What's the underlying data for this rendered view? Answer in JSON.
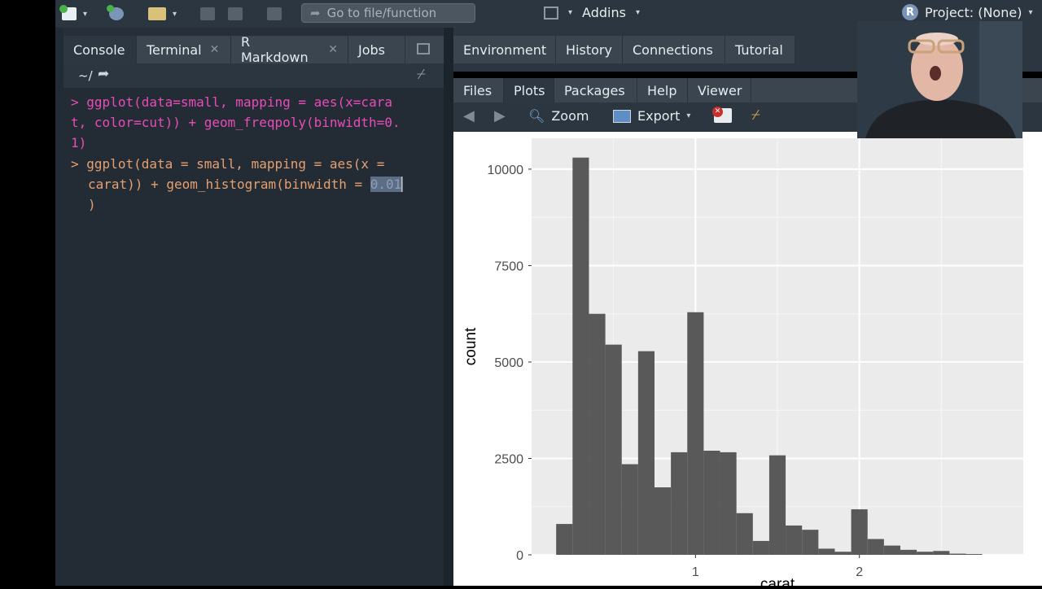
{
  "toolbar": {
    "goto_placeholder": "Go to file/function",
    "addins_label": "Addins",
    "project_label": "Project: (None)",
    "project_logo": "R"
  },
  "console_pane": {
    "tabs": [
      {
        "label": "Console",
        "closable": false
      },
      {
        "label": "Terminal",
        "closable": true
      },
      {
        "label": "R Markdown",
        "closable": true
      },
      {
        "label": "Jobs",
        "closable": false
      }
    ],
    "path": "~/",
    "lines": [
      {
        "prompt": ">",
        "text": "ggplot(data=small, mapping = aes(x=cara"
      },
      {
        "prompt": "",
        "text": "t, color=cut)) + geom_freqpoly(binwidth=0."
      },
      {
        "prompt": "",
        "text": "1)"
      },
      {
        "prompt": ">",
        "text": "ggplot(data = small, mapping = aes(x ="
      },
      {
        "prompt": "",
        "text": "carat)) + geom_histogram(binwidth = ",
        "selected": "0.01"
      },
      {
        "prompt": "",
        "text": ")"
      }
    ]
  },
  "env_pane": {
    "tabs": [
      "Environment",
      "History",
      "Connections",
      "Tutorial"
    ]
  },
  "plots_pane": {
    "tabs": [
      "Files",
      "Plots",
      "Packages",
      "Help",
      "Viewer"
    ],
    "active_tab": "Plots",
    "zoom_label": "Zoom",
    "export_label": "Export"
  },
  "colors": {
    "prompt_pink": "#e94bb8",
    "code_peach": "#e6a070",
    "bar_fill": "#595959",
    "panel_bg": "#ebebeb"
  },
  "chart_data": {
    "type": "bar",
    "title": "",
    "xlabel": "carat",
    "ylabel": "count",
    "x_ticks": [
      1,
      2
    ],
    "y_ticks": [
      0,
      2500,
      5000,
      7500,
      10000
    ],
    "xlim": [
      0.0,
      3.0
    ],
    "ylim": [
      0,
      10800
    ],
    "grid": true,
    "bin_width": 0.1,
    "bin_centers": [
      0.2,
      0.3,
      0.4,
      0.5,
      0.6,
      0.7,
      0.8,
      0.9,
      1.0,
      1.1,
      1.2,
      1.3,
      1.4,
      1.5,
      1.6,
      1.7,
      1.8,
      1.9,
      2.0,
      2.1,
      2.2,
      2.3,
      2.4,
      2.5,
      2.6,
      2.7
    ],
    "values": [
      800,
      10300,
      6250,
      5450,
      2350,
      5280,
      1750,
      2660,
      6290,
      2700,
      2660,
      1080,
      360,
      2580,
      760,
      650,
      160,
      80,
      1180,
      410,
      240,
      130,
      80,
      100,
      30,
      20
    ]
  }
}
